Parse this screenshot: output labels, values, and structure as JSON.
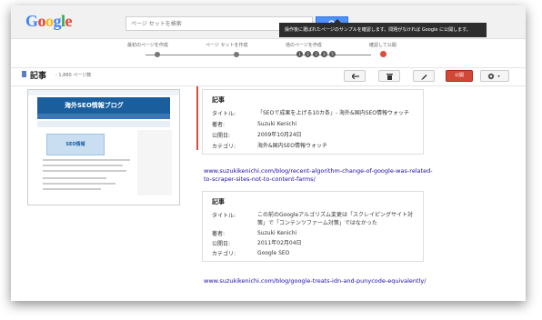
{
  "header": {
    "logo": {
      "letters": [
        "G",
        "o",
        "o",
        "g",
        "l",
        "e"
      ],
      "colors": [
        "#4285f4",
        "#ea4335",
        "#fbbc05",
        "#4285f4",
        "#34a853",
        "#ea4335"
      ]
    },
    "search": {
      "placeholder": "ページ セットを検索"
    },
    "tooltip": "操作後に選ばれたページのサンプルを確認します。問題がなければ Google に公開します。"
  },
  "steps": {
    "labels": [
      "最初のページを作成",
      "ページ セットを作成",
      "他のページを作成",
      "確認して公開"
    ],
    "numbers": [
      "1",
      "2",
      "3",
      "4",
      "5"
    ],
    "current_color": "#dd4b39"
  },
  "toolbar": {
    "title": "記事",
    "count": "- 1,860 ページ数",
    "back_icon": "arrow-left-icon",
    "delete_icon": "trash-icon",
    "edit_icon": "pencil-icon",
    "publish_label": "公開",
    "settings_icon": "gear-icon",
    "publish_color": "#d14836"
  },
  "thumbnail": {
    "banner_title": "海外SEO情報ブログ",
    "seo_badge": "SEO情報"
  },
  "cards": [
    {
      "title": "記事",
      "fields": [
        {
          "key": "タイトル:",
          "value": "「SEOで成果を上げる10カ条」- 海外&国内SEO情報ウォッチ"
        },
        {
          "key": "著者:",
          "value": "Suzuki Kenichi"
        },
        {
          "key": "公開日:",
          "value": "2009年10月24日"
        },
        {
          "key": "カテゴリ:",
          "value": "海外&国内SEO情報ウォッチ"
        }
      ]
    },
    {
      "url": "www.suzukikenichi.com/blog/recent-algorithm-change-of-google-was-related-to-scraper-sites-not-to-content-farms/",
      "title": "記事",
      "fields": [
        {
          "key": "タイトル:",
          "value": "この前のGoogleアルゴリズム変更は「スクレイピングサイト対策」で「コンテンツファーム対策」ではなかった"
        },
        {
          "key": "著者:",
          "value": "Suzuki Kenichi"
        },
        {
          "key": "公開日:",
          "value": "2011年02月04日"
        },
        {
          "key": "カテゴリ:",
          "value": "Google SEO"
        }
      ]
    },
    {
      "url": "www.suzukikenichi.com/blog/google-treats-idn-and-punycode-equivalently/"
    }
  ]
}
